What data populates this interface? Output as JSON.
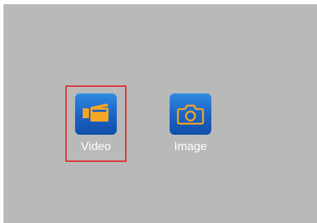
{
  "menu": {
    "items": [
      {
        "label": "Video",
        "icon": "video-camera-icon",
        "selected": true
      },
      {
        "label": "Image",
        "icon": "camera-icon",
        "selected": false
      }
    ]
  },
  "colors": {
    "background": "#b9b9b9",
    "selection_border": "#e02a2a",
    "icon_bg": "#1a62c4",
    "icon_fg": "#f5a623",
    "label": "#ffffff"
  }
}
